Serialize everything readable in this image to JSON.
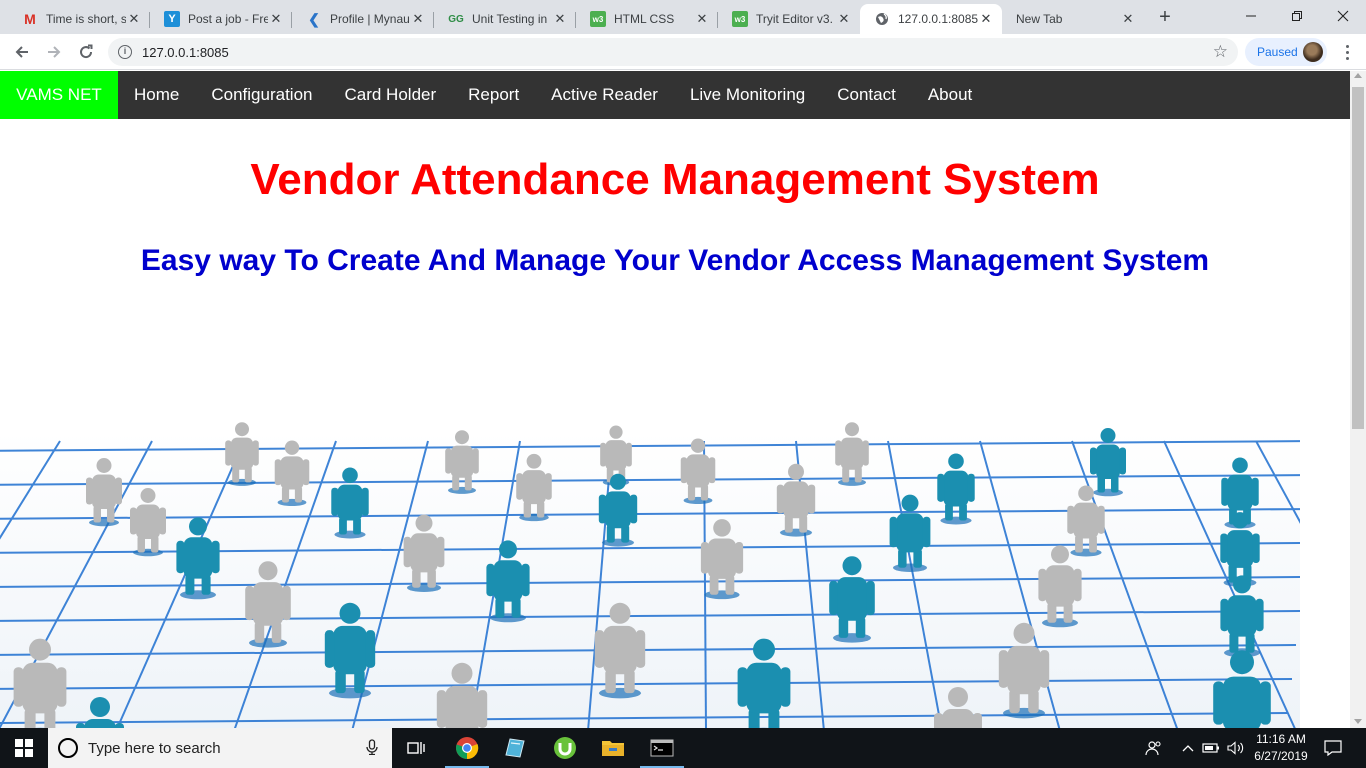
{
  "browser": {
    "tabs": [
      {
        "title": "Time is short, s",
        "favicon": "gmail-icon",
        "active": false
      },
      {
        "title": "Post a job - Fre",
        "favicon": "freelancer-icon",
        "active": false
      },
      {
        "title": "Profile | Mynau",
        "favicon": "mynaukri-icon",
        "active": false
      },
      {
        "title": "Unit Testing in",
        "favicon": "geeksforgeeks-icon",
        "active": false
      },
      {
        "title": "HTML CSS",
        "favicon": "w3schools-icon",
        "active": false
      },
      {
        "title": "Tryit Editor v3.",
        "favicon": "w3schools-icon",
        "active": false
      },
      {
        "title": "127.0.0.1:8085",
        "favicon": "globe-icon",
        "active": true
      },
      {
        "title": "New Tab",
        "favicon": "",
        "active": false
      }
    ],
    "address": "127.0.0.1:8085",
    "profile_label": "Paused"
  },
  "site": {
    "brand": "VAMS NET",
    "nav": [
      "Home",
      "Configuration",
      "Card Holder",
      "Report",
      "Active Reader",
      "Live Monitoring",
      "Contact",
      "About"
    ],
    "headline": "Vendor Attendance Management System",
    "tagline": "Easy way To Create And Manage Your Vendor Access Management System",
    "hero_image": "network-of-people-figures-illustration",
    "colors": {
      "brand_bg": "#00ff00",
      "nav_bg": "#333333",
      "headline": "#ff0000",
      "tagline": "#0000cd",
      "figure_blue": "#1b8fb0",
      "figure_gray": "#b9b9b9",
      "grid_line": "#1e6fd0"
    }
  },
  "taskbar": {
    "search_placeholder": "Type here to search",
    "time": "11:16 AM",
    "date": "6/27/2019"
  }
}
